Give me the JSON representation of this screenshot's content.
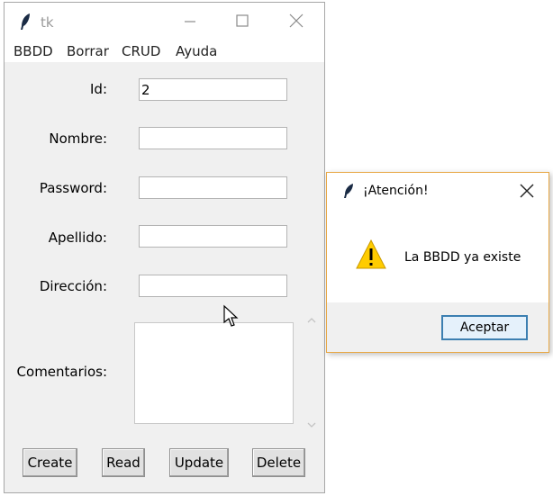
{
  "window": {
    "title": "tk",
    "menu": [
      "BBDD",
      "Borrar",
      "CRUD",
      "Ayuda"
    ]
  },
  "form": {
    "labels": {
      "id": "Id:",
      "nombre": "Nombre:",
      "password": "Password:",
      "apellido": "Apellido:",
      "direccion": "Dirección:",
      "comentarios": "Comentarios:"
    },
    "values": {
      "id": "2",
      "nombre": "",
      "password": "",
      "apellido": "",
      "direccion": "",
      "comentarios": ""
    }
  },
  "buttons": {
    "create": "Create",
    "read": "Read",
    "update": "Update",
    "delete": "Delete"
  },
  "dialog": {
    "title": "¡Atención!",
    "message": "La BBDD ya existe",
    "ok_label": "Aceptar",
    "icon": "warning-icon"
  },
  "colors": {
    "dialog_border": "#e8a845",
    "ok_border": "#3c7fb1",
    "warning": "#ffcc00"
  }
}
